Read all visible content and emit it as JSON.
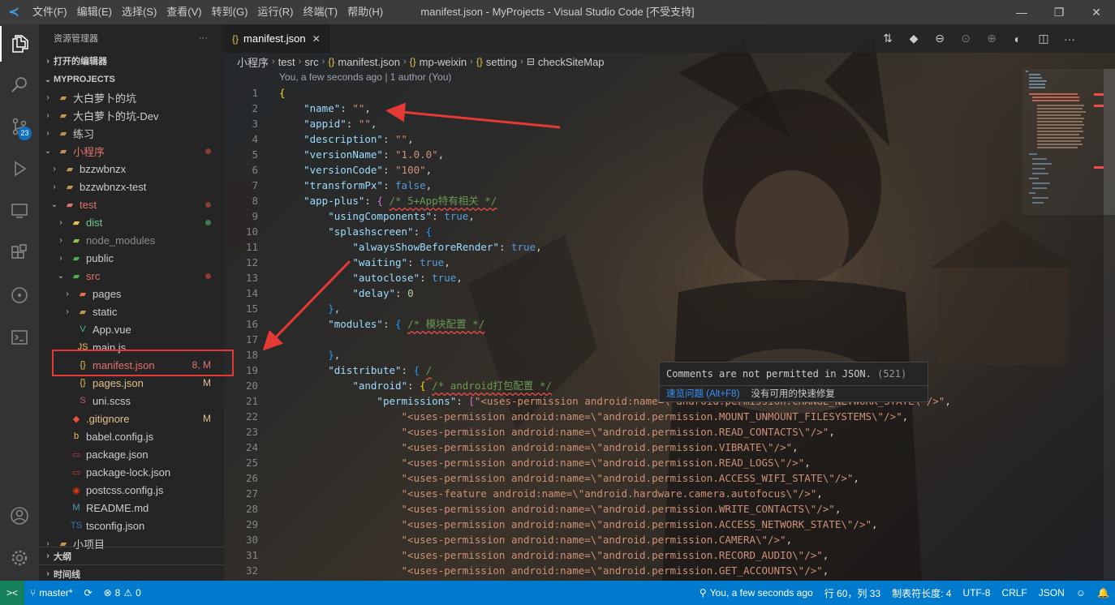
{
  "window": {
    "title": "manifest.json - MyProjects - Visual Studio Code [不受支持]",
    "menu": [
      "文件(F)",
      "编辑(E)",
      "选择(S)",
      "查看(V)",
      "转到(G)",
      "运行(R)",
      "终端(T)",
      "帮助(H)"
    ]
  },
  "activity": {
    "scm_badge": "23",
    "icons": [
      "explorer-icon",
      "search-icon",
      "source-control-icon",
      "run-debug-icon",
      "remote-explorer-icon",
      "extensions-icon",
      "git-graph-icon",
      "terminal-icon",
      "account-icon",
      "settings-gear-icon"
    ]
  },
  "sidebar": {
    "title": "资源管理器",
    "more": "···",
    "open_editors": "打开的编辑器",
    "workspace": "MYPROJECTS",
    "outline": "大纲",
    "timeline": "时间线",
    "tree": [
      {
        "label": "大白萝卜的坑",
        "type": "folder",
        "depth": 1,
        "open": false,
        "color": "#cccccc",
        "status": ""
      },
      {
        "label": "大白萝卜的坑-Dev",
        "type": "folder",
        "depth": 1,
        "open": false,
        "color": "#cccccc",
        "status": ""
      },
      {
        "label": "练习",
        "type": "folder",
        "depth": 1,
        "open": false,
        "color": "#cccccc",
        "status": ""
      },
      {
        "label": "小程序",
        "type": "folder",
        "depth": 1,
        "open": true,
        "color": "#e2736a",
        "status": "dot"
      },
      {
        "label": "bzzwbnzx",
        "type": "folder",
        "depth": 2,
        "open": false,
        "color": "#cccccc",
        "status": ""
      },
      {
        "label": "bzzwbnzx-test",
        "type": "folder",
        "depth": 2,
        "open": false,
        "color": "#cccccc",
        "status": ""
      },
      {
        "label": "test",
        "type": "folder-test",
        "depth": 2,
        "open": true,
        "color": "#e2736a",
        "status": "dot"
      },
      {
        "label": "dist",
        "type": "folder-dist",
        "depth": 3,
        "open": false,
        "color": "#73c991",
        "status": "greendot"
      },
      {
        "label": "node_modules",
        "type": "folder-node",
        "depth": 3,
        "open": false,
        "color": "#8c8c8c",
        "status": ""
      },
      {
        "label": "public",
        "type": "folder-public",
        "depth": 3,
        "open": false,
        "color": "#cccccc",
        "status": ""
      },
      {
        "label": "src",
        "type": "folder-src",
        "depth": 3,
        "open": true,
        "color": "#e2736a",
        "status": "dot"
      },
      {
        "label": "pages",
        "type": "folder-pages",
        "depth": 4,
        "open": false,
        "color": "#cccccc",
        "status": ""
      },
      {
        "label": "static",
        "type": "folder",
        "depth": 4,
        "open": false,
        "color": "#cccccc",
        "status": ""
      },
      {
        "label": "App.vue",
        "type": "vue",
        "depth": 4,
        "open": null,
        "color": "#cccccc",
        "status": ""
      },
      {
        "label": "main.js",
        "type": "js",
        "depth": 4,
        "open": null,
        "color": "#cccccc",
        "status": ""
      },
      {
        "label": "manifest.json",
        "type": "json",
        "depth": 4,
        "open": null,
        "color": "#e2736a",
        "status": "8, M"
      },
      {
        "label": "pages.json",
        "type": "json",
        "depth": 4,
        "open": null,
        "color": "#e2c08d",
        "status": "M"
      },
      {
        "label": "uni.scss",
        "type": "scss",
        "depth": 4,
        "open": null,
        "color": "#cccccc",
        "status": ""
      },
      {
        "label": ".gitignore",
        "type": "git",
        "depth": 3,
        "open": null,
        "color": "#e2c08d",
        "status": "M"
      },
      {
        "label": "babel.config.js",
        "type": "babel",
        "depth": 3,
        "open": null,
        "color": "#cccccc",
        "status": ""
      },
      {
        "label": "package.json",
        "type": "npm",
        "depth": 3,
        "open": null,
        "color": "#cccccc",
        "status": ""
      },
      {
        "label": "package-lock.json",
        "type": "npm",
        "depth": 3,
        "open": null,
        "color": "#cccccc",
        "status": ""
      },
      {
        "label": "postcss.config.js",
        "type": "postcss",
        "depth": 3,
        "open": null,
        "color": "#cccccc",
        "status": ""
      },
      {
        "label": "README.md",
        "type": "md",
        "depth": 3,
        "open": null,
        "color": "#cccccc",
        "status": ""
      },
      {
        "label": "tsconfig.json",
        "type": "ts",
        "depth": 3,
        "open": null,
        "color": "#cccccc",
        "status": ""
      },
      {
        "label": "小项目",
        "type": "folder",
        "depth": 1,
        "open": false,
        "color": "#cccccc",
        "status": ""
      }
    ]
  },
  "editor": {
    "tab": "manifest.json",
    "tab_close": "✕",
    "breadcrumb": [
      "小程序",
      "test",
      "src",
      "manifest.json",
      "mp-weixin",
      "setting",
      "checkSiteMap"
    ],
    "blame": "You, a few seconds ago | 1 author (You)",
    "lines": [
      {
        "n": "1",
        "t": [
          [
            "{",
            "br"
          ]
        ]
      },
      {
        "n": "2",
        "t": [
          [
            "    ",
            "p"
          ],
          [
            "\"name\"",
            "k"
          ],
          [
            ": ",
            "p"
          ],
          [
            "\"\"",
            "s"
          ],
          [
            ",",
            "p"
          ]
        ]
      },
      {
        "n": "3",
        "t": [
          [
            "    ",
            "p"
          ],
          [
            "\"appid\"",
            "k"
          ],
          [
            ": ",
            "p"
          ],
          [
            "\"\"",
            "s"
          ],
          [
            ",",
            "p"
          ]
        ]
      },
      {
        "n": "4",
        "t": [
          [
            "    ",
            "p"
          ],
          [
            "\"description\"",
            "k"
          ],
          [
            ": ",
            "p"
          ],
          [
            "\"\"",
            "s"
          ],
          [
            ",",
            "p"
          ]
        ]
      },
      {
        "n": "5",
        "t": [
          [
            "    ",
            "p"
          ],
          [
            "\"versionName\"",
            "k"
          ],
          [
            ": ",
            "p"
          ],
          [
            "\"1.0.0\"",
            "s"
          ],
          [
            ",",
            "p"
          ]
        ]
      },
      {
        "n": "6",
        "t": [
          [
            "    ",
            "p"
          ],
          [
            "\"versionCode\"",
            "k"
          ],
          [
            ": ",
            "p"
          ],
          [
            "\"100\"",
            "s"
          ],
          [
            ",",
            "p"
          ]
        ]
      },
      {
        "n": "7",
        "t": [
          [
            "    ",
            "p"
          ],
          [
            "\"transformPx\"",
            "k"
          ],
          [
            ": ",
            "p"
          ],
          [
            "false",
            "b"
          ],
          [
            ",",
            "p"
          ]
        ]
      },
      {
        "n": "8",
        "t": [
          [
            "    ",
            "p"
          ],
          [
            "\"app-plus\"",
            "k"
          ],
          [
            ": ",
            "p"
          ],
          [
            "{ ",
            "br2"
          ],
          [
            "/* 5+App特有相关 */",
            "c"
          ]
        ]
      },
      {
        "n": "9",
        "t": [
          [
            "        ",
            "p"
          ],
          [
            "\"usingComponents\"",
            "k"
          ],
          [
            ": ",
            "p"
          ],
          [
            "true",
            "b"
          ],
          [
            ",",
            "p"
          ]
        ]
      },
      {
        "n": "10",
        "t": [
          [
            "        ",
            "p"
          ],
          [
            "\"splashscreen\"",
            "k"
          ],
          [
            ": ",
            "p"
          ],
          [
            "{",
            "br3"
          ]
        ]
      },
      {
        "n": "11",
        "t": [
          [
            "            ",
            "p"
          ],
          [
            "\"alwaysShowBeforeRender\"",
            "k"
          ],
          [
            ": ",
            "p"
          ],
          [
            "true",
            "b"
          ],
          [
            ",",
            "p"
          ]
        ]
      },
      {
        "n": "12",
        "t": [
          [
            "            ",
            "p"
          ],
          [
            "\"waiting\"",
            "k"
          ],
          [
            ": ",
            "p"
          ],
          [
            "true",
            "b"
          ],
          [
            ",",
            "p"
          ]
        ]
      },
      {
        "n": "13",
        "t": [
          [
            "            ",
            "p"
          ],
          [
            "\"autoclose\"",
            "k"
          ],
          [
            ": ",
            "p"
          ],
          [
            "true",
            "b"
          ],
          [
            ",",
            "p"
          ]
        ]
      },
      {
        "n": "14",
        "t": [
          [
            "            ",
            "p"
          ],
          [
            "\"delay\"",
            "k"
          ],
          [
            ": ",
            "p"
          ],
          [
            "0",
            "n"
          ]
        ]
      },
      {
        "n": "15",
        "t": [
          [
            "        ",
            "p"
          ],
          [
            "}",
            "br3"
          ],
          [
            ",",
            "p"
          ]
        ]
      },
      {
        "n": "16",
        "t": [
          [
            "        ",
            "p"
          ],
          [
            "\"modules\"",
            "k"
          ],
          [
            ": ",
            "p"
          ],
          [
            "{ ",
            "br3"
          ],
          [
            "/* 模块配置 */",
            "c"
          ]
        ]
      },
      {
        "n": "17",
        "t": []
      },
      {
        "n": "18",
        "t": [
          [
            "        ",
            "p"
          ],
          [
            "}",
            "br3"
          ],
          [
            ",",
            "p"
          ]
        ]
      },
      {
        "n": "19",
        "t": [
          [
            "        ",
            "p"
          ],
          [
            "\"distribute\"",
            "k"
          ],
          [
            ": ",
            "p"
          ],
          [
            "{ ",
            "br3"
          ],
          [
            "/",
            "c"
          ]
        ]
      },
      {
        "n": "20",
        "t": [
          [
            "            ",
            "p"
          ],
          [
            "\"android\"",
            "k"
          ],
          [
            ": ",
            "p"
          ],
          [
            "{ ",
            "br"
          ],
          [
            "/* android打包配置 */",
            "c"
          ]
        ]
      },
      {
        "n": "21",
        "t": [
          [
            "                ",
            "p"
          ],
          [
            "\"permissions\"",
            "k"
          ],
          [
            ": ",
            "p"
          ],
          [
            "[",
            "br2"
          ],
          [
            "\"<uses-permission android:name=\\\"android.permission.CHANGE_NETWORK_STATE\\\"/>\"",
            "s"
          ],
          [
            ",",
            "p"
          ]
        ]
      },
      {
        "n": "22",
        "t": [
          [
            "                    ",
            "p"
          ],
          [
            "\"<uses-permission android:name=\\\"android.permission.MOUNT_UNMOUNT_FILESYSTEMS\\\"/>\"",
            "s"
          ],
          [
            ",",
            "p"
          ]
        ]
      },
      {
        "n": "23",
        "t": [
          [
            "                    ",
            "p"
          ],
          [
            "\"<uses-permission android:name=\\\"android.permission.READ_CONTACTS\\\"/>\"",
            "s"
          ],
          [
            ",",
            "p"
          ]
        ]
      },
      {
        "n": "24",
        "t": [
          [
            "                    ",
            "p"
          ],
          [
            "\"<uses-permission android:name=\\\"android.permission.VIBRATE\\\"/>\"",
            "s"
          ],
          [
            ",",
            "p"
          ]
        ]
      },
      {
        "n": "25",
        "t": [
          [
            "                    ",
            "p"
          ],
          [
            "\"<uses-permission android:name=\\\"android.permission.READ_LOGS\\\"/>\"",
            "s"
          ],
          [
            ",",
            "p"
          ]
        ]
      },
      {
        "n": "26",
        "t": [
          [
            "                    ",
            "p"
          ],
          [
            "\"<uses-permission android:name=\\\"android.permission.ACCESS_WIFI_STATE\\\"/>\"",
            "s"
          ],
          [
            ",",
            "p"
          ]
        ]
      },
      {
        "n": "27",
        "t": [
          [
            "                    ",
            "p"
          ],
          [
            "\"<uses-feature android:name=\\\"android.hardware.camera.autofocus\\\"/>\"",
            "s"
          ],
          [
            ",",
            "p"
          ]
        ]
      },
      {
        "n": "28",
        "t": [
          [
            "                    ",
            "p"
          ],
          [
            "\"<uses-permission android:name=\\\"android.permission.WRITE_CONTACTS\\\"/>\"",
            "s"
          ],
          [
            ",",
            "p"
          ]
        ]
      },
      {
        "n": "29",
        "t": [
          [
            "                    ",
            "p"
          ],
          [
            "\"<uses-permission android:name=\\\"android.permission.ACCESS_NETWORK_STATE\\\"/>\"",
            "s"
          ],
          [
            ",",
            "p"
          ]
        ]
      },
      {
        "n": "30",
        "t": [
          [
            "                    ",
            "p"
          ],
          [
            "\"<uses-permission android:name=\\\"android.permission.CAMERA\\\"/>\"",
            "s"
          ],
          [
            ",",
            "p"
          ]
        ]
      },
      {
        "n": "31",
        "t": [
          [
            "                    ",
            "p"
          ],
          [
            "\"<uses-permission android:name=\\\"android.permission.RECORD_AUDIO\\\"/>\"",
            "s"
          ],
          [
            ",",
            "p"
          ]
        ]
      },
      {
        "n": "32",
        "t": [
          [
            "                    ",
            "p"
          ],
          [
            "\"<uses-permission android:name=\\\"android.permission.GET_ACCOUNTS\\\"/>\"",
            "s"
          ],
          [
            ",",
            "p"
          ]
        ]
      }
    ],
    "hover": {
      "message": "Comments are not permitted in JSON.",
      "code": "(521)",
      "quick_look": "速览问题 (Alt+F8)",
      "no_fix": "没有可用的快速修复"
    }
  },
  "status": {
    "branch": "master*",
    "problems": "8",
    "warnings": "0",
    "blame": "You, a few seconds ago",
    "cursor": "行 60，列 33",
    "tab_size": "制表符长度: 4",
    "encoding": "UTF-8",
    "eol": "CRLF",
    "language": "JSON"
  },
  "colors": {
    "accent": "#007acc",
    "annotation": "#e53935"
  }
}
